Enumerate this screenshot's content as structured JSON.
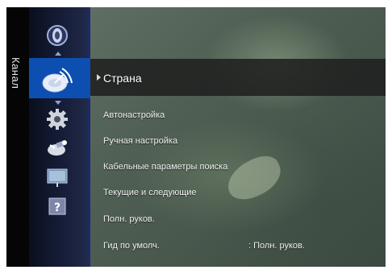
{
  "sidebar": {
    "category_label": "Канал"
  },
  "icons": [
    "sound-icon",
    "antenna-icon",
    "setup-gear-icon",
    "satellite-icon",
    "input-icon",
    "help-icon"
  ],
  "help_glyph": "?",
  "menu": {
    "selected_item": "Страна",
    "items": [
      {
        "label": "Автонастройка"
      },
      {
        "label": "Ручная настройка"
      },
      {
        "label": "Кабельные  параметры поиска"
      },
      {
        "label": "Текущие и следующие"
      },
      {
        "label": "Полн. руков."
      },
      {
        "label": "Гид по умолч.",
        "value": ": Полн. руков."
      }
    ]
  },
  "colors": {
    "selection_blue": "#0d4fb0",
    "highlight_bar": "#202020"
  }
}
